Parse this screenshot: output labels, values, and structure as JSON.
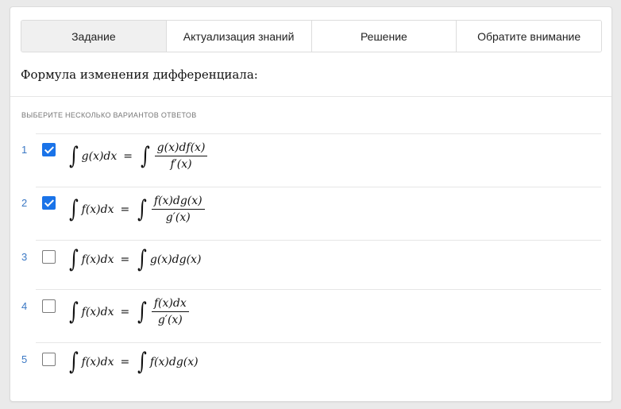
{
  "tabs": [
    {
      "label": "Задание",
      "active": true
    },
    {
      "label": "Актуализация знаний",
      "active": false
    },
    {
      "label": "Решение",
      "active": false
    },
    {
      "label": "Обратите внимание",
      "active": false
    }
  ],
  "title": "Формула изменения дифференциала:",
  "instruction": "ВЫБЕРИТЕ НЕСКОЛЬКО ВАРИАНТОВ ОТВЕТОВ",
  "options": [
    {
      "num": "1",
      "checked": true,
      "lhs": "g(x)dx",
      "eq": "=",
      "rhs_num": "g(x)df(x)",
      "rhs_den": "f′(x)"
    },
    {
      "num": "2",
      "checked": true,
      "lhs": "f(x)dx",
      "eq": "=",
      "rhs_num": "f(x)dg(x)",
      "rhs_den": "g′(x)"
    },
    {
      "num": "3",
      "checked": false,
      "lhs": "f(x)dx",
      "eq": "=",
      "rhs": "g(x)dg(x)"
    },
    {
      "num": "4",
      "checked": false,
      "lhs": "f(x)dx",
      "eq": "=",
      "rhs_num": "f(x)dx",
      "rhs_den": "g′(x)"
    },
    {
      "num": "5",
      "checked": false,
      "lhs": "f(x)dx",
      "eq": "=",
      "rhs": "f(x)dg(x)"
    }
  ],
  "colors": {
    "accent": "#1a73e8",
    "number": "#3b78c4"
  }
}
